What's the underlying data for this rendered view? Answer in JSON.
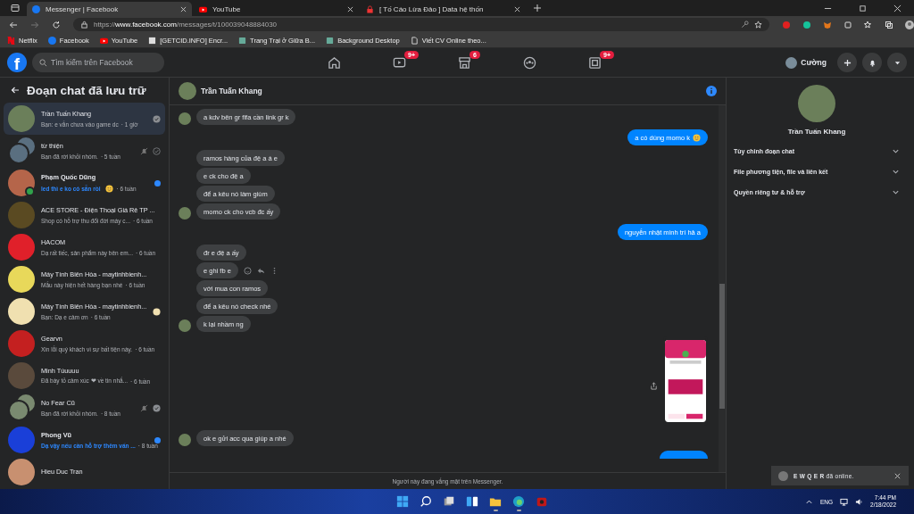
{
  "browser": {
    "tabs": [
      {
        "title": "Messenger | Facebook",
        "kind": "facebook",
        "selected": true
      },
      {
        "title": "YouTube",
        "kind": "youtube",
        "selected": false
      },
      {
        "title": "[ Tố Cáo Lừa Đảo ] Data hệ thốn",
        "kind": "lock",
        "selected": false
      }
    ],
    "url_prefix": "https://",
    "url_host": "www.facebook.com",
    "url_path": "/messages/t/100039048884030",
    "bookmarks": [
      {
        "label": "Netflix",
        "kind": "netflix"
      },
      {
        "label": "Facebook",
        "kind": "facebook"
      },
      {
        "label": "YouTube",
        "kind": "youtube"
      },
      {
        "label": "[GETCID.INFO] Encr...",
        "kind": "page"
      },
      {
        "label": "Trang Trại ở Giữa B...",
        "kind": "app"
      },
      {
        "label": "Background Desktop",
        "kind": "app"
      },
      {
        "label": "Viết CV Online theo...",
        "kind": "doc"
      }
    ]
  },
  "facebook_nav": {
    "logo": "f",
    "search_placeholder": "Tìm kiếm trên Facebook",
    "nav": [
      {
        "kind": "home"
      },
      {
        "kind": "watch",
        "badge": "9+"
      },
      {
        "kind": "marketplace",
        "badge": "6"
      },
      {
        "kind": "groups"
      },
      {
        "kind": "gaming",
        "badge": "9+"
      }
    ],
    "user": "Cường"
  },
  "sidebar": {
    "title": "Đoạn chat đã lưu trữ",
    "chats": [
      {
        "name": "Trần Tuấn Khang",
        "preview": "Bạn: e vẫn chưa vào game dc",
        "time": "· 1 giờ",
        "selected": true,
        "unread": false,
        "muted": false,
        "seen": true,
        "color": "#6b7f5a"
      },
      {
        "name": "từ thiện",
        "preview": "Bạn đã rời khỏi nhóm.",
        "time": "· 5 tuần",
        "selected": false,
        "unread": false,
        "muted": true,
        "sent": true,
        "color": "#5a6f80",
        "group": true
      },
      {
        "name": "Phạm Quốc Dũng",
        "preview": "led thì e ko có sẵn rồi",
        "emoji": true,
        "time": "· 6 tuần",
        "selected": false,
        "unread": true,
        "muted": false,
        "color": "#b5654a",
        "online": true
      },
      {
        "name": "ACE STORE - Điện Thoại Giá Rẻ TP ...",
        "preview": "Shop có hỗ trợ thu đổi đời máy c...",
        "time": "· 6 tuần",
        "selected": false,
        "unread": false,
        "muted": false,
        "color": "#5a4a22"
      },
      {
        "name": "HACOM",
        "preview": "Dạ rất tiếc, sản phẩm này bên em...",
        "time": "· 6 tuần",
        "selected": false,
        "unread": false,
        "muted": false,
        "color": "#e0202a"
      },
      {
        "name": "Máy Tính Biên Hòa - maytinhbienh...",
        "preview": "Mẫu này hiện hết hàng bạn nhé",
        "time": "· 6 tuần",
        "selected": false,
        "unread": false,
        "muted": false,
        "color": "#e8d85a"
      },
      {
        "name": "Máy Tính Biên Hòa - maytinhbienh...",
        "preview": "Bạn: Dạ e cảm ơn",
        "time": "· 6 tuần",
        "selected": false,
        "unread": false,
        "muted": false,
        "seen_avatar": true,
        "color": "#f0e0b0"
      },
      {
        "name": "Gearvn",
        "preview": "Xin lỗi quý khách vì sự bất tiện này.",
        "time": "· 6 tuần",
        "selected": false,
        "unread": false,
        "muted": false,
        "color": "#c42020"
      },
      {
        "name": "Minh Túuuuu",
        "preview": "Đã bày tỏ cảm xúc ❤ về tin nhắ...",
        "time": "· 6 tuần",
        "selected": false,
        "unread": false,
        "muted": false,
        "color": "#5a4a3c"
      },
      {
        "name": "No Fear Cũ",
        "preview": "Bạn đã rời khỏi nhóm.",
        "time": "· 8 tuần",
        "selected": false,
        "unread": false,
        "muted": true,
        "seen": true,
        "color": "#7a8a70",
        "group": true
      },
      {
        "name": "Phong Vũ",
        "preview": "Dạ vậy nếu cần hỗ trợ thêm vấn ...",
        "time": "· 8 tuần",
        "selected": false,
        "unread": true,
        "muted": false,
        "color": "#1a3fd8"
      },
      {
        "name": "Hieu Duc Tran",
        "selected": false,
        "unread": false,
        "color": "#c89070"
      }
    ]
  },
  "chat": {
    "name": "Trần Tuấn Khang",
    "groups": [
      {
        "outgoing": false,
        "messages": [
          {
            "kind": "text",
            "text": "a kdv bên gr fifa cần link gr k"
          }
        ]
      },
      {
        "outgoing": true,
        "messages": [
          {
            "kind": "text",
            "text": "a có dùng momo k",
            "emoji": true
          }
        ]
      },
      {
        "outgoing": false,
        "messages": [
          {
            "kind": "text",
            "text": "ramos hàng của đệ a á e"
          },
          {
            "kind": "text",
            "text": "e ck cho đệ a"
          },
          {
            "kind": "text",
            "text": "để a kêu nó làm giùm"
          },
          {
            "kind": "text",
            "text": "momo ck cho vcb đc ấy"
          }
        ]
      },
      {
        "outgoing": true,
        "messages": [
          {
            "kind": "text",
            "text": "nguyễn nhật minh trí hả a"
          }
        ]
      },
      {
        "outgoing": false,
        "messages": [
          {
            "kind": "text",
            "text": "đr e đệ a ấy"
          },
          {
            "kind": "text",
            "text": "e ghi fb e",
            "hover_actions": true
          },
          {
            "kind": "text",
            "text": "với mua con ramos"
          },
          {
            "kind": "text",
            "text": "để a kêu nó check nhé"
          },
          {
            "kind": "text",
            "text": "k lại nhầm ng"
          }
        ]
      },
      {
        "outgoing": true,
        "messages": [
          {
            "kind": "image"
          }
        ]
      },
      {
        "outgoing": false,
        "messages": [
          {
            "kind": "text",
            "text": "ok e gửi acc qua giúp a nhé"
          }
        ]
      },
      {
        "outgoing": true,
        "messages": [
          {
            "kind": "partial"
          }
        ]
      }
    ],
    "footer": "Người này đang vắng mặt trên Messenger."
  },
  "info_panel": {
    "name": "Trần Tuấn Khang",
    "sections": [
      "Tùy chỉnh đoạn chat",
      "File phương tiện, file và liên kết",
      "Quyền riêng tư & hỗ trợ"
    ]
  },
  "notification": {
    "text": "**E W Q E R** đã online."
  },
  "taskbar": {
    "apps": [
      {
        "kind": "start"
      },
      {
        "kind": "search"
      },
      {
        "kind": "taskview"
      },
      {
        "kind": "widgets"
      },
      {
        "kind": "explorer",
        "running": true
      },
      {
        "kind": "edge",
        "running": true
      },
      {
        "kind": "game",
        "running": false
      }
    ],
    "language": "ENG",
    "time": "7:44 PM",
    "date": "2/18/2022"
  }
}
